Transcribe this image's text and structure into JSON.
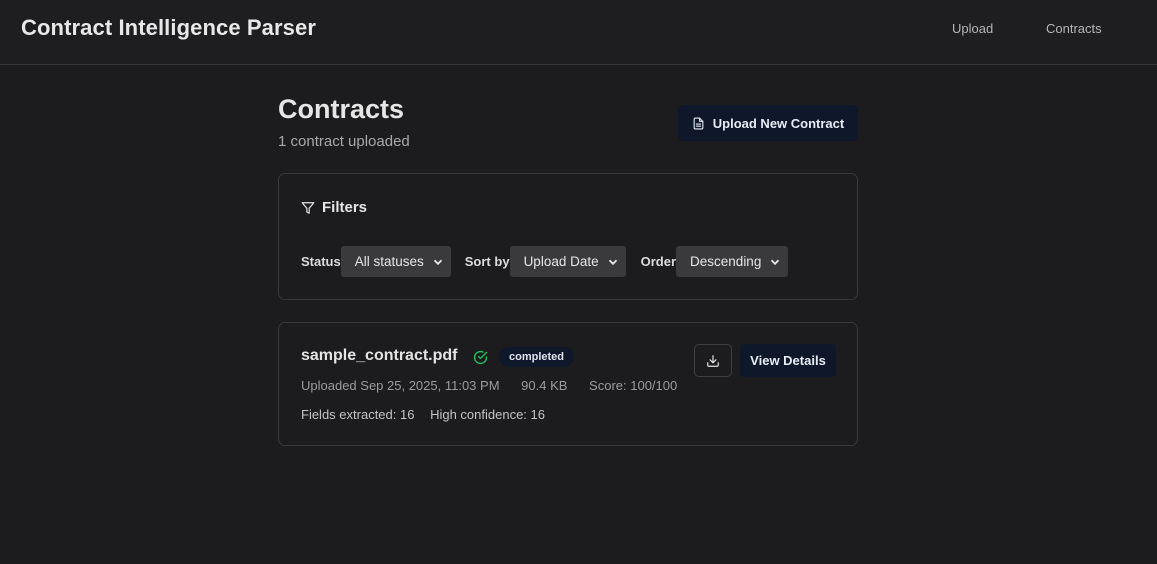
{
  "header": {
    "app_title": "Contract Intelligence Parser",
    "nav": [
      {
        "label": "Upload"
      },
      {
        "label": "Contracts"
      }
    ]
  },
  "main": {
    "title": "Contracts",
    "subtitle": "1 contract uploaded",
    "upload_button_label": "Upload New Contract",
    "upload_button_icon": "file-icon"
  },
  "filters": {
    "heading": "Filters",
    "heading_icon": "filter-icon",
    "status": {
      "label": "Status",
      "value": "All statuses"
    },
    "sort_by": {
      "label": "Sort by",
      "value": "Upload Date"
    },
    "order": {
      "label": "Order",
      "value": "Descending"
    }
  },
  "contracts": [
    {
      "filename": "sample_contract.pdf",
      "status_icon": "check-circle-icon",
      "status": "completed",
      "uploaded": "Uploaded Sep 25, 2025, 11:03 PM",
      "size": "90.4 KB",
      "score": "Score: 100/100",
      "fields_extracted": "Fields extracted: 16",
      "high_confidence": "High confidence: 16",
      "download_icon": "download-icon",
      "view_label": "View Details"
    }
  ],
  "colors": {
    "background": "#1c1c1e",
    "primary_button": "#0f172a",
    "success": "#22c55e",
    "border": "#36383d"
  }
}
